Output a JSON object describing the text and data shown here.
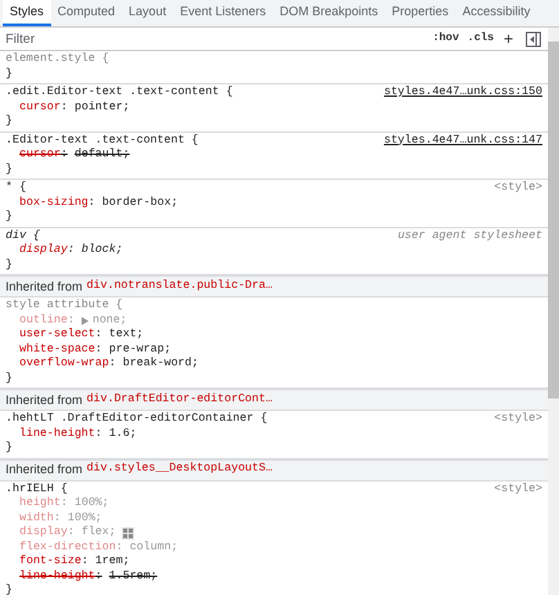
{
  "tabs": [
    {
      "label": "Styles",
      "selected": true
    },
    {
      "label": "Computed",
      "selected": false
    },
    {
      "label": "Layout",
      "selected": false
    },
    {
      "label": "Event Listeners",
      "selected": false
    },
    {
      "label": "DOM Breakpoints",
      "selected": false
    },
    {
      "label": "Properties",
      "selected": false
    },
    {
      "label": "Accessibility",
      "selected": false
    }
  ],
  "toolbar": {
    "filter": {
      "placeholder": "Filter"
    },
    "hov": ":hov",
    "cls": ".cls",
    "add": "+"
  },
  "sections": [
    {
      "kind": "rule",
      "selector": "element.style {",
      "selector_faded": true,
      "selector_italic": false,
      "close": "}"
    },
    {
      "kind": "rule",
      "selector": ".edit.Editor-text .text-content {",
      "selector_faded": false,
      "selector_italic": false,
      "source": {
        "text": "styles.4e47…unk.css:150",
        "kind": "link"
      },
      "declarations": [
        {
          "property": "cursor",
          "colon": ":",
          "value": "pointer;",
          "inactive": false,
          "overridden": false
        }
      ],
      "close": "}"
    },
    {
      "kind": "rule",
      "selector": ".Editor-text .text-content {",
      "selector_faded": false,
      "selector_italic": false,
      "source": {
        "text": "styles.4e47…unk.css:147",
        "kind": "link"
      },
      "declarations": [
        {
          "property": "cursor",
          "colon": ":",
          "value": "default;",
          "inactive": false,
          "overridden": true
        }
      ],
      "close": "}"
    },
    {
      "kind": "rule",
      "selector": "* {",
      "selector_faded": false,
      "selector_italic": false,
      "source": {
        "text": "<style>",
        "kind": "style"
      },
      "declarations": [
        {
          "property": "box-sizing",
          "colon": ":",
          "value": "border-box;",
          "inactive": false,
          "overridden": false
        }
      ],
      "close": "}"
    },
    {
      "kind": "rule",
      "selector": "div {",
      "selector_faded": false,
      "selector_italic": true,
      "source": {
        "text": "user agent stylesheet",
        "kind": "user_agent"
      },
      "declarations": [
        {
          "property": "display",
          "colon": ":",
          "value": "block;",
          "inactive": false,
          "overridden": false,
          "italic": true
        }
      ],
      "close": "}"
    },
    {
      "kind": "inherited",
      "label": "Inherited from",
      "element": "div.notranslate.public-Dra…"
    },
    {
      "kind": "rule",
      "selector": "style attribute {",
      "selector_faded": true,
      "selector_italic": false,
      "declarations": [
        {
          "property": "outline",
          "colon": ":",
          "value": "none;",
          "inactive": true,
          "overridden": false,
          "expander": true
        },
        {
          "property": "user-select",
          "colon": ":",
          "value": "text;",
          "inactive": false,
          "overridden": false
        },
        {
          "property": "white-space",
          "colon": ":",
          "value": "pre-wrap;",
          "inactive": false,
          "overridden": false
        },
        {
          "property": "overflow-wrap",
          "colon": ":",
          "value": "break-word;",
          "inactive": false,
          "overridden": false
        }
      ],
      "close": "}"
    },
    {
      "kind": "inherited",
      "label": "Inherited from",
      "element": "div.DraftEditor-editorCont…"
    },
    {
      "kind": "rule",
      "selector": ".hehtLT .DraftEditor-editorContainer {",
      "selector_faded": false,
      "selector_italic": false,
      "source": {
        "text": "<style>",
        "kind": "style"
      },
      "declarations": [
        {
          "property": "line-height",
          "colon": ":",
          "value": "1.6;",
          "inactive": false,
          "overridden": false
        }
      ],
      "close": "}"
    },
    {
      "kind": "inherited",
      "label": "Inherited from",
      "element": "div.styles__DesktopLayoutS…"
    },
    {
      "kind": "rule",
      "selector": ".hrIELH {",
      "selector_faded": false,
      "selector_italic": false,
      "source": {
        "text": "<style>",
        "kind": "style"
      },
      "declarations": [
        {
          "property": "height",
          "colon": ":",
          "value": "100%;",
          "inactive": true,
          "overridden": false
        },
        {
          "property": "width",
          "colon": ":",
          "value": "100%;",
          "inactive": true,
          "overridden": false
        },
        {
          "property": "display",
          "colon": ":",
          "value": "flex;",
          "inactive": true,
          "overridden": false,
          "flex_editor": true
        },
        {
          "property": "flex-direction",
          "colon": ":",
          "value": "column;",
          "inactive": true,
          "overridden": false
        },
        {
          "property": "font-size",
          "colon": ":",
          "value": "1rem;",
          "inactive": false,
          "overridden": false
        },
        {
          "property": "line-height",
          "colon": ":",
          "value": "1.5rem;",
          "inactive": false,
          "overridden": true
        }
      ],
      "close": "}"
    }
  ]
}
